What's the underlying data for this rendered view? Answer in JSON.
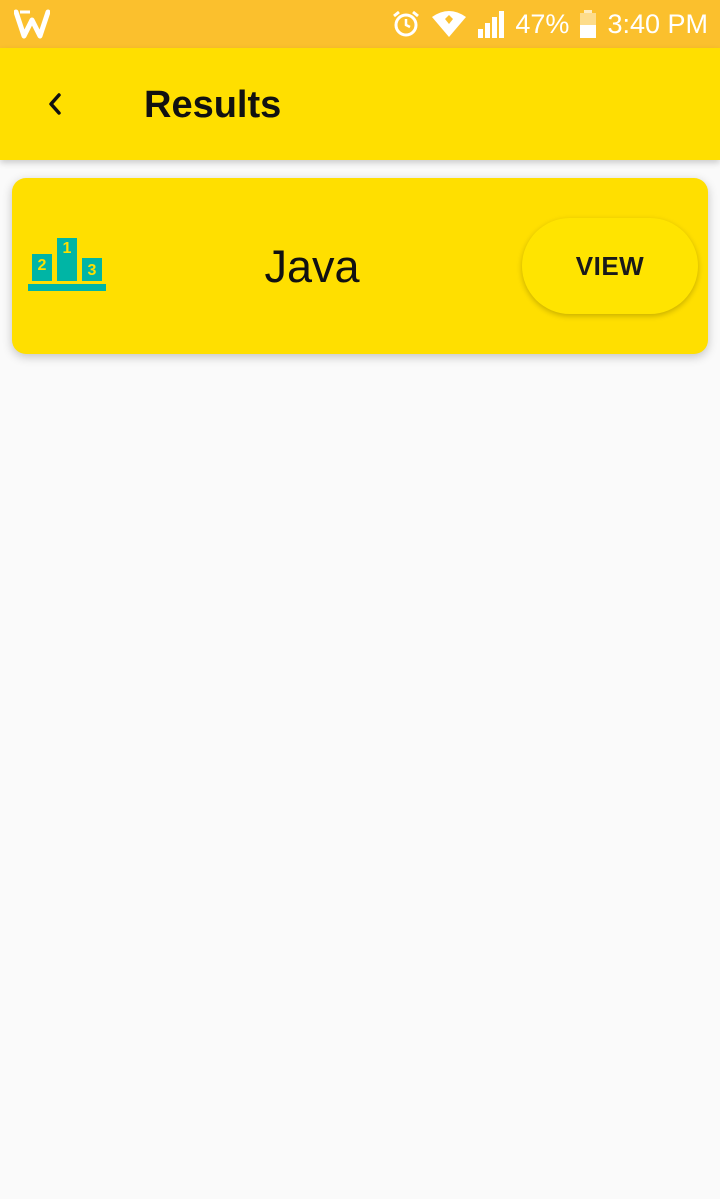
{
  "status_bar": {
    "battery_percent": "47%",
    "time": "3:40 PM",
    "icons": [
      "w-app-icon",
      "alarm-icon",
      "wifi-icon",
      "signal-icon",
      "battery-icon"
    ]
  },
  "app_bar": {
    "title": "Results",
    "back_icon": "chevron-left-icon"
  },
  "results": [
    {
      "icon": "podium-icon",
      "podium_labels": [
        "1",
        "2",
        "3"
      ],
      "title": "Java",
      "button_label": "VIEW"
    }
  ],
  "colors": {
    "status_bar": "#fbc02d",
    "app_bar": "#ffdf00",
    "card": "#ffdf00",
    "podium": "#00b5a5",
    "background": "#fafafa"
  }
}
